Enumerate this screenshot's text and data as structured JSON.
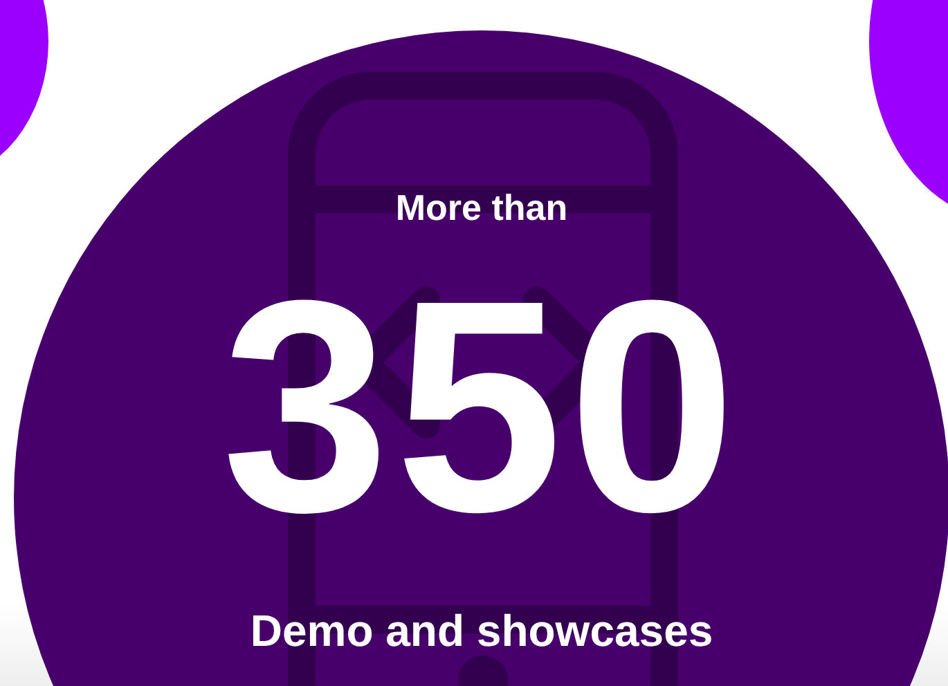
{
  "stat": {
    "prefix": "More than",
    "value": "350",
    "caption": "Demo and showcases"
  }
}
